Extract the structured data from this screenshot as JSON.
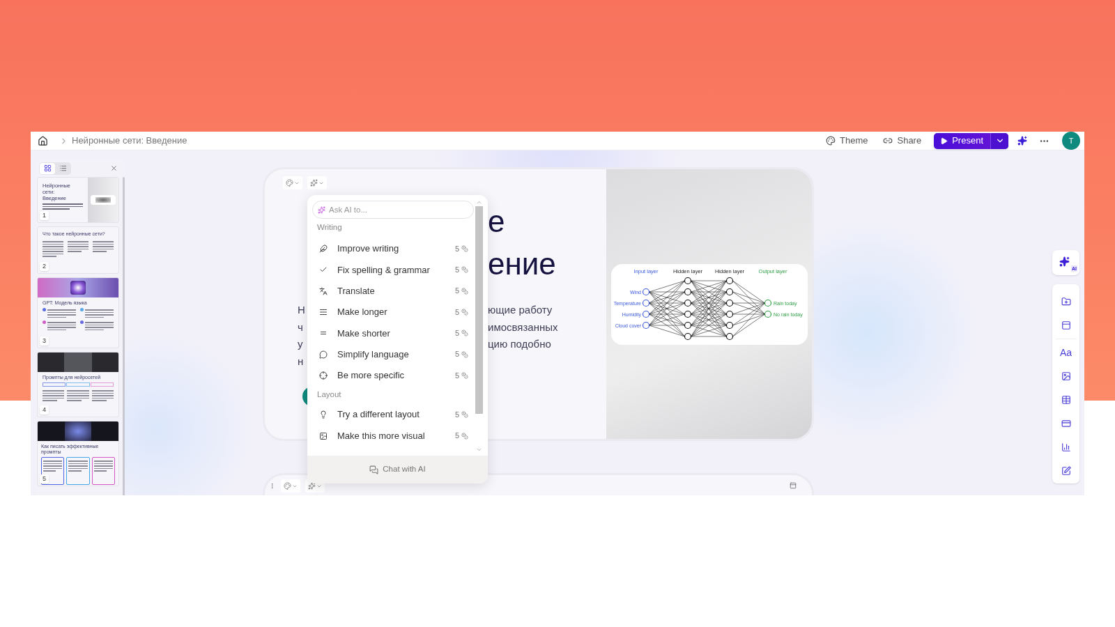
{
  "top_bar": {
    "breadcrumb": "Нейронные сети: Введение",
    "actions": [
      {
        "kind": "theme",
        "label": "Theme"
      },
      {
        "kind": "share",
        "label": "Share"
      }
    ],
    "present": "Present",
    "avatar": "T"
  },
  "sidebar": {
    "view_toggle": [
      {
        "kind": "thumbnails",
        "selected": true
      },
      {
        "kind": "list",
        "selected": false
      }
    ],
    "slides": [
      {
        "kind": "title_image",
        "number": "1",
        "title": "Нейронные сети: Введение"
      },
      {
        "kind": "columns",
        "number": "2",
        "title": "Что такое нейронные сети?"
      },
      {
        "kind": "banner_cards",
        "number": "3",
        "title": "GPT: Модель языка"
      },
      {
        "kind": "banner_steps",
        "number": "4",
        "title": "Промпты для нейросетей"
      },
      {
        "kind": "banner_boxes",
        "number": "5",
        "title": "Как писать эффективные промпты"
      }
    ]
  },
  "slide": {
    "title_lines": [
      {
        "right": "е"
      },
      {
        "right": "ение"
      }
    ],
    "body_lines": [
      {
        "left": "Н",
        "right": "ющие работу"
      },
      {
        "left": "ч",
        "right": "имосвязанных"
      },
      {
        "left": "у",
        "right": "цию подобно"
      },
      {
        "left": "н"
      }
    ],
    "diagram": {
      "input": {
        "title": "Input layer",
        "nodes": [
          "Wind",
          "Temperature",
          "Humidity",
          "Cloud cover"
        ]
      },
      "hidden": [
        "Hidden layer",
        "Hidden layer"
      ],
      "output": {
        "title": "Output layer",
        "nodes": [
          "Rain today",
          "No rain today"
        ]
      }
    }
  },
  "ai_menu": {
    "placeholder": "Ask AI to...",
    "sections": [
      {
        "title": "Writing",
        "items": [
          {
            "kind": "pen",
            "label": "Improve writing",
            "cost": "5"
          },
          {
            "kind": "check",
            "label": "Fix spelling & grammar",
            "cost": "5"
          },
          {
            "kind": "translate",
            "label": "Translate",
            "cost": "5"
          },
          {
            "kind": "lines",
            "label": "Make longer",
            "cost": "5"
          },
          {
            "kind": "equal",
            "label": "Make shorter",
            "cost": "5"
          },
          {
            "kind": "speech",
            "label": "Simplify language",
            "cost": "5"
          },
          {
            "kind": "target",
            "label": "Be more specific",
            "cost": "5"
          }
        ]
      },
      {
        "title": "Layout",
        "items": [
          {
            "kind": "bulb",
            "label": "Try a different layout",
            "cost": "5"
          },
          {
            "kind": "image",
            "label": "Make this more visual",
            "cost": "5"
          }
        ]
      }
    ],
    "footer": "Chat with AI"
  },
  "right_toolbar": {
    "ai_badge": "AI",
    "tools": [
      {
        "kind": "card"
      },
      {
        "kind": "layout"
      },
      {
        "kind": "text",
        "label": "Aa"
      },
      {
        "kind": "image"
      },
      {
        "kind": "table"
      },
      {
        "kind": "banner"
      },
      {
        "kind": "chart"
      },
      {
        "kind": "form"
      }
    ]
  }
}
